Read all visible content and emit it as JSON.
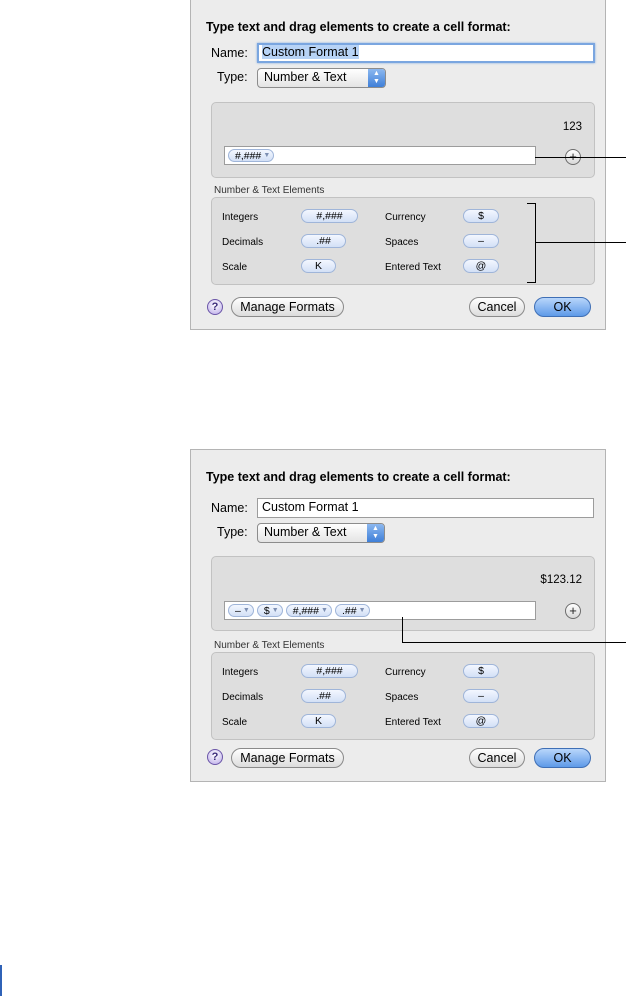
{
  "dialog1": {
    "heading": "Type text and drag elements to create a cell format:",
    "name_label": "Name:",
    "name_value": "Custom Format 1",
    "type_label": "Type:",
    "type_value": "Number & Text",
    "sample": "123",
    "format_tokens": [
      "#,###"
    ],
    "section_title": "Number & Text Elements",
    "elements": [
      {
        "label": "Integers",
        "token": "#,###"
      },
      {
        "label": "Decimals",
        "token": ".##"
      },
      {
        "label": "Scale",
        "token": "K"
      },
      {
        "label": "Currency",
        "token": "$"
      },
      {
        "label": "Spaces",
        "token": "–"
      },
      {
        "label": "Entered Text",
        "token": "@"
      }
    ],
    "help_label": "?",
    "manage_label": "Manage Formats",
    "cancel_label": "Cancel",
    "ok_label": "OK",
    "plus_label": "+"
  },
  "dialog2": {
    "heading": "Type text and drag elements to create a cell format:",
    "name_label": "Name:",
    "name_value": "Custom Format 1",
    "type_label": "Type:",
    "type_value": "Number & Text",
    "sample": "$123.12",
    "format_tokens": [
      "–",
      "$",
      "#,###",
      ".##"
    ],
    "section_title": "Number & Text Elements",
    "elements": [
      {
        "label": "Integers",
        "token": "#,###"
      },
      {
        "label": "Decimals",
        "token": ".##"
      },
      {
        "label": "Scale",
        "token": "K"
      },
      {
        "label": "Currency",
        "token": "$"
      },
      {
        "label": "Spaces",
        "token": "–"
      },
      {
        "label": "Entered Text",
        "token": "@"
      }
    ],
    "help_label": "?",
    "manage_label": "Manage Formats",
    "cancel_label": "Cancel",
    "ok_label": "OK",
    "plus_label": "+"
  }
}
